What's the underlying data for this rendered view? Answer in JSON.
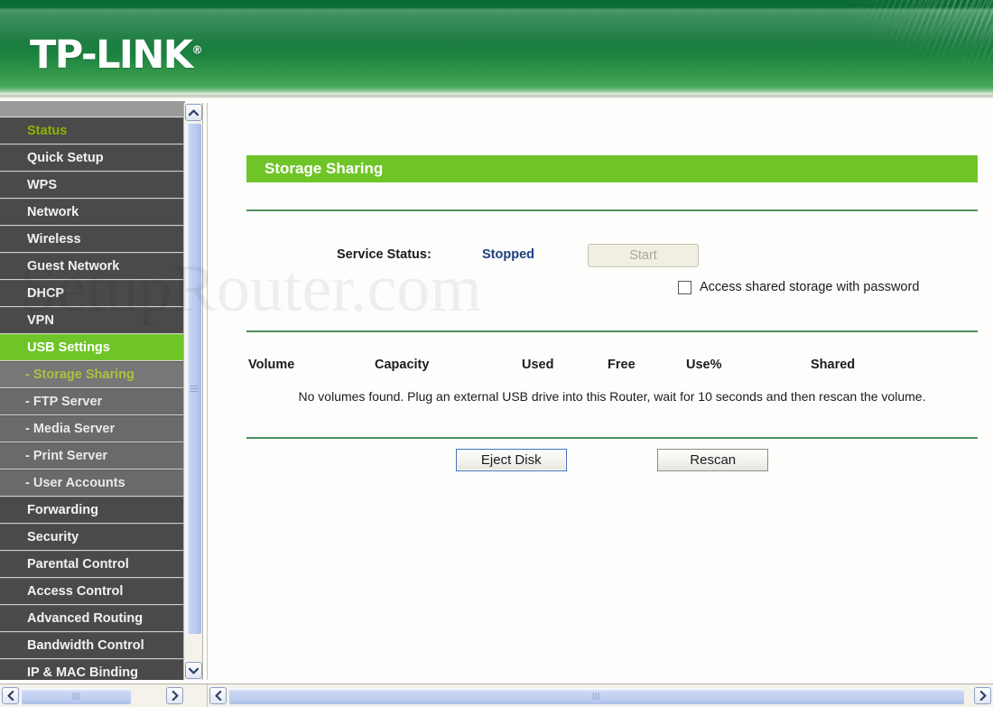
{
  "header": {
    "logo_text": "TP-LINK",
    "logo_trademark": "®"
  },
  "watermark": {
    "text": "SetupRouter.com"
  },
  "sidebar": {
    "items": [
      {
        "label": "Status",
        "kind": "status"
      },
      {
        "label": "Quick Setup",
        "kind": "main"
      },
      {
        "label": "WPS",
        "kind": "main"
      },
      {
        "label": "Network",
        "kind": "main"
      },
      {
        "label": "Wireless",
        "kind": "main"
      },
      {
        "label": "Guest Network",
        "kind": "main"
      },
      {
        "label": "DHCP",
        "kind": "main"
      },
      {
        "label": "VPN",
        "kind": "main"
      },
      {
        "label": "USB Settings",
        "kind": "active"
      },
      {
        "label": "- Storage Sharing",
        "kind": "sub-selected"
      },
      {
        "label": "- FTP Server",
        "kind": "sub"
      },
      {
        "label": "- Media Server",
        "kind": "sub"
      },
      {
        "label": "- Print Server",
        "kind": "sub"
      },
      {
        "label": "- User Accounts",
        "kind": "sub"
      },
      {
        "label": "Forwarding",
        "kind": "main"
      },
      {
        "label": "Security",
        "kind": "main"
      },
      {
        "label": "Parental Control",
        "kind": "main"
      },
      {
        "label": "Access Control",
        "kind": "main"
      },
      {
        "label": "Advanced Routing",
        "kind": "main"
      },
      {
        "label": "Bandwidth Control",
        "kind": "main"
      },
      {
        "label": "IP & MAC Binding",
        "kind": "main"
      }
    ]
  },
  "main": {
    "page_title": "Storage Sharing",
    "service_status_label": "Service Status:",
    "service_status_value": "Stopped",
    "start_button_label": "Start",
    "password_checkbox_label": "Access shared storage with password",
    "password_checkbox_checked": false,
    "table": {
      "columns": [
        "Volume",
        "Capacity",
        "Used",
        "Free",
        "Use%",
        "Shared"
      ],
      "rows": [],
      "empty_message": "No volumes found. Plug an external USB drive into this Router, wait for 10 seconds and then rescan the volume."
    },
    "actions": {
      "eject_label": "Eject Disk",
      "rescan_label": "Rescan"
    }
  },
  "colors": {
    "brand_green": "#6fc528",
    "header_green": "#19803f",
    "status_value_blue": "#1f3f7d",
    "menu_status_text": "#8ab500",
    "separator_green": "#4d8f5f"
  }
}
